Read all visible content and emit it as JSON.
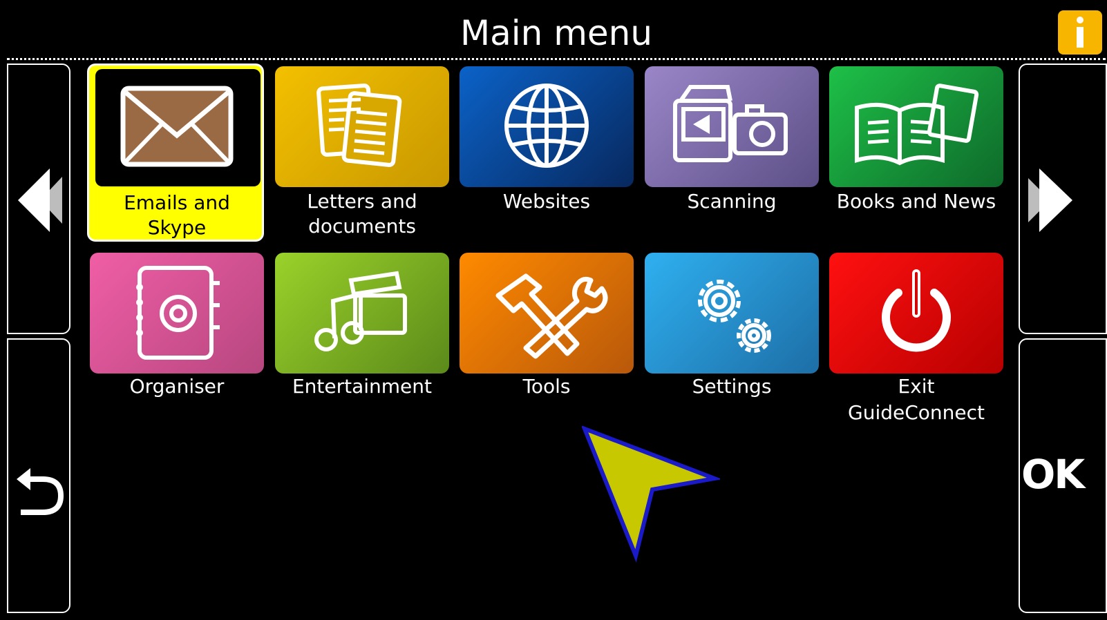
{
  "header": {
    "title": "Main menu",
    "info_glyph": "i"
  },
  "nav": {
    "prev_icon": "double-left-arrow",
    "next_icon": "double-right-arrow",
    "back_icon": "return-arrow",
    "ok_label": "OK"
  },
  "tiles": [
    {
      "label_line1": "Emails and",
      "label_line2": "Skype",
      "icon": "envelope-icon",
      "color": "#000000"
    },
    {
      "label_line1": "Letters and",
      "label_line2": "documents",
      "icon": "documents-icon",
      "color": "#e1a800"
    },
    {
      "label_line1": "Websites",
      "label_line2": "",
      "icon": "globe-icon",
      "color": "#0a4a9e"
    },
    {
      "label_line1": "Scanning",
      "label_line2": "",
      "icon": "scanner-camera-icon",
      "color": "#7a6aa6"
    },
    {
      "label_line1": "Books and News",
      "label_line2": "",
      "icon": "book-news-icon",
      "color": "#1a8f3a"
    },
    {
      "label_line1": "Organiser",
      "label_line2": "",
      "icon": "address-book-icon",
      "color": "#d6508f"
    },
    {
      "label_line1": "Entertainment",
      "label_line2": "",
      "icon": "music-clapper-icon",
      "color": "#6f9f1f"
    },
    {
      "label_line1": "Tools",
      "label_line2": "",
      "icon": "hammer-wrench-icon",
      "color": "#e56d00"
    },
    {
      "label_line1": "Settings",
      "label_line2": "",
      "icon": "gears-icon",
      "color": "#2c8fd0"
    },
    {
      "label_line1": "Exit",
      "label_line2": "GuideConnect",
      "icon": "power-icon",
      "color": "#e00000"
    }
  ],
  "selected_index": 0,
  "colors": {
    "selected_highlight": "#ffff00",
    "info_button": "#f7b500",
    "cursor_fill": "#c8c800",
    "cursor_border": "#1a1ac8"
  }
}
